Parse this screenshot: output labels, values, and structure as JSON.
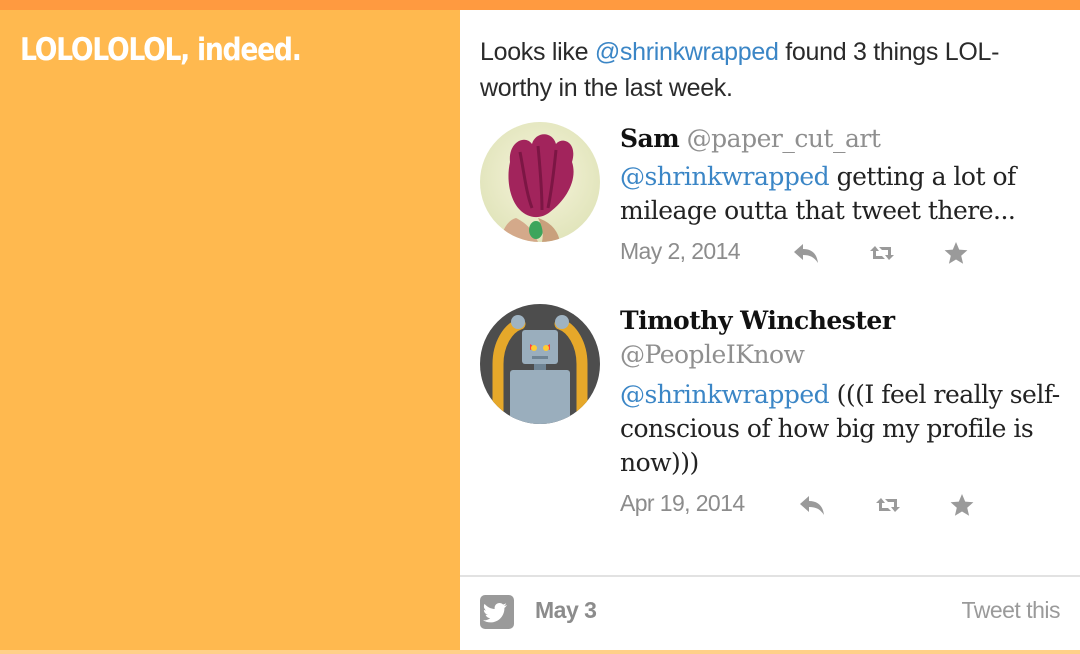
{
  "page": {
    "title": "LOLOLOLOL, indeed."
  },
  "intro": {
    "prefix": "Looks like ",
    "mention": "@shrinkwrapped",
    "suffix": " found 3 things LOL-worthy in the last week."
  },
  "tweets": [
    {
      "name": "Sam",
      "handle": "@paper_cut_art",
      "mention": "@shrinkwrapped",
      "text": " getting a lot of mileage outta that tweet there...",
      "date": "May 2, 2014",
      "avatar": "yarn-flower-avatar"
    },
    {
      "name": "Timothy Winchester",
      "handle": "@PeopleIKnow",
      "mention": "@shrinkwrapped",
      "text": " (((I feel really self-conscious of how big my profile is now)))",
      "date": "Apr 19, 2014",
      "avatar": "robot-avatar"
    }
  ],
  "icons": [
    "reply-icon",
    "retweet-icon",
    "favorite-icon",
    "twitter-bird-icon"
  ],
  "footer": {
    "date": "May 3",
    "tweet_this": "Tweet this"
  },
  "colors": {
    "left_panel": "#ffb94f",
    "top_bar": "#ff9a40",
    "link": "#3b86c6",
    "muted": "#8c8c8c"
  }
}
